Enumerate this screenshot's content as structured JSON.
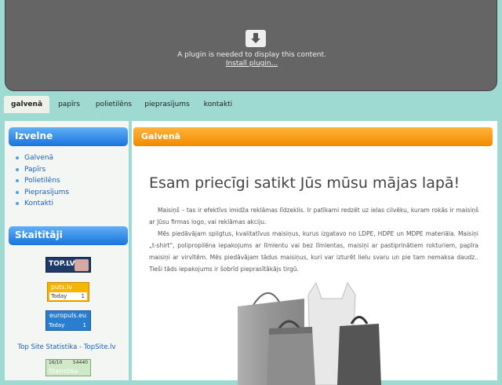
{
  "plugin": {
    "message": "A plugin is needed to display this content.",
    "install_link": "Install plugin..."
  },
  "nav": {
    "items": [
      {
        "label": "galvenā",
        "active": true
      },
      {
        "label": "papīrs"
      },
      {
        "label": "polietilēns"
      },
      {
        "label": "pieprasījums"
      },
      {
        "label": "kontakti"
      }
    ]
  },
  "sidebar": {
    "menu_title": "Izvelne",
    "menu_items": [
      "Galvenā",
      "Papīrs",
      "Polietilēns",
      "Pieprasījums",
      "Kontakti"
    ],
    "counters_title": "Skaitītāji",
    "counters": {
      "toplv": "TOP.LV",
      "puts": {
        "brand": "puts.lv",
        "label": "Today",
        "value": "1"
      },
      "europuls": {
        "brand": "europuls.eu",
        "label": "Today",
        "value": "1"
      },
      "topsite_link": "Top Site Statistika - TopSite.lv",
      "stat": {
        "left": "16/10",
        "right": "54440",
        "label": "Statistika"
      }
    }
  },
  "main": {
    "header": "Galvenā",
    "title": "Esam priecīgi satikt Jūs mūsu mājas lapā!",
    "paragraphs": [
      "Maisiņš – tas ir efektīvs imidža reklāmas līdzeklis. Ir patīkami redzēt uz ielas cilvēku, kuram rokās ir maisiņš ar Jūsu firmas logo, vai reklāmas akciju.",
      "Mēs piedāvājam spilgtus, kvalitatīvus maisiņus, kurus izgatavo no LDPE, HDPE un MDPE materiāla. Maisiņi „t-shirt“, polipropilēna iepakojums ar līmlentu vai bez līmlentas, maisiņi ar pastiprinātiem rokturiem, papīra maisiņi ar virvītēm. Mēs piedāvājam tādus maisiņus, kuri var izturēt lielu svaru un pie tam nemaksa daudz.. Tieši tāds iepakojums ir šobrīd pieprasītākājs tirgū."
    ]
  },
  "colors": {
    "background": "#9ed9d2",
    "sidebar_header": "#1a73dd",
    "main_header": "#f08a00",
    "link": "#1a5fb8"
  }
}
